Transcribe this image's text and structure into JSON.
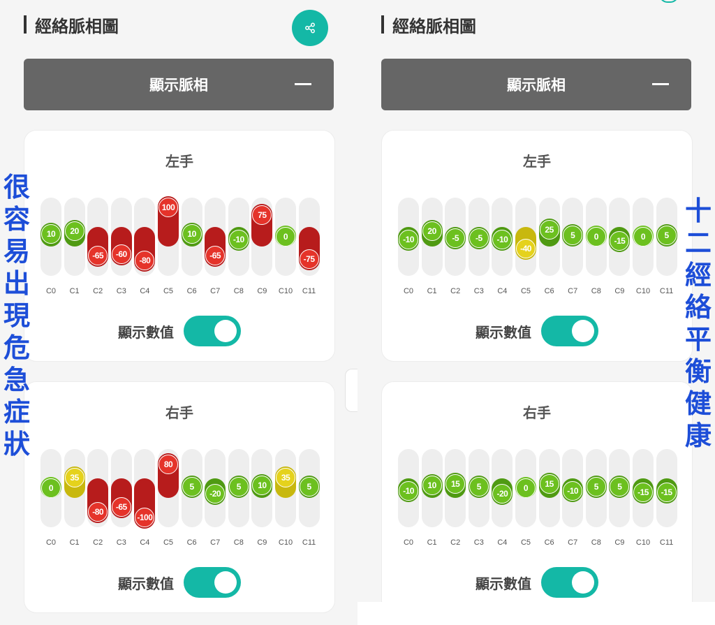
{
  "colors": {
    "green": "#6cc01f",
    "green_dark": "#4f9a12",
    "red": "#e5332a",
    "red_dark": "#b71c1c",
    "yellow": "#e5d21c",
    "yellow_dark": "#c8b80e",
    "accent": "#14b8a6",
    "annotation": "#1d4ed8"
  },
  "annotations": {
    "left": [
      "很",
      "容",
      "易",
      "出",
      "現",
      "危",
      "急",
      "症",
      "狀"
    ],
    "right": [
      "十",
      "二",
      "經",
      "絡",
      "平",
      "衡",
      "健",
      "康"
    ]
  },
  "panels": [
    {
      "section_title": "經絡脈相圖",
      "header_label": "顯示脈相",
      "share_icon": "share-icon",
      "cards": [
        {
          "title": "左手",
          "values": [
            10,
            20,
            -65,
            -60,
            -80,
            100,
            10,
            -65,
            -10,
            75,
            0,
            -75
          ],
          "switch_label": "顯示數值",
          "switch_on": true
        },
        {
          "title": "右手",
          "values": [
            0,
            35,
            -80,
            -65,
            -100,
            80,
            5,
            -20,
            5,
            10,
            35,
            5
          ],
          "switch_label": "顯示數值",
          "switch_on": true
        }
      ]
    },
    {
      "section_title": "經絡脈相圖",
      "header_label": "顯示脈相",
      "cards": [
        {
          "title": "左手",
          "values": [
            -10,
            20,
            -5,
            -5,
            -10,
            -40,
            25,
            5,
            0,
            -15,
            0,
            5
          ],
          "switch_label": "顯示數值",
          "switch_on": true
        },
        {
          "title": "右手",
          "values": [
            -10,
            10,
            15,
            5,
            -20,
            0,
            15,
            -10,
            5,
            5,
            -15,
            -15
          ],
          "switch_label": "顯示數值",
          "switch_on": true
        }
      ]
    }
  ],
  "channels": [
    "C0",
    "C1",
    "C2",
    "C3",
    "C4",
    "C5",
    "C6",
    "C7",
    "C8",
    "C9",
    "C10",
    "C11"
  ]
}
